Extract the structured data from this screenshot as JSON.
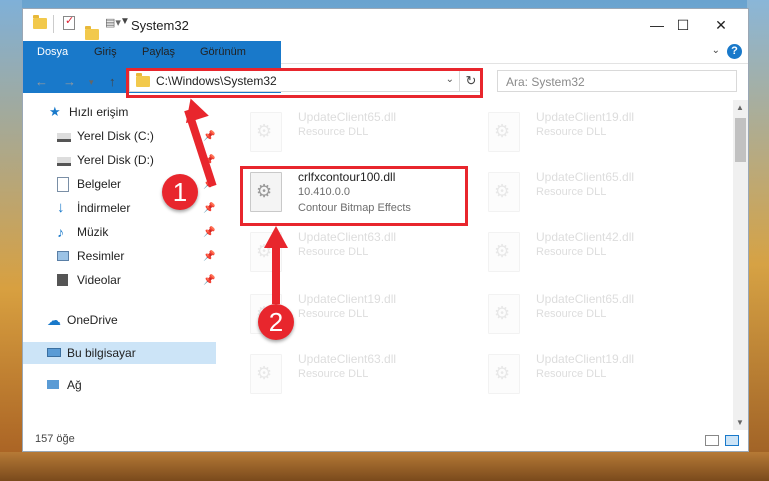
{
  "window": {
    "title": "System32"
  },
  "ribbon": {
    "tabs": [
      "Dosya",
      "Giriş",
      "Paylaş",
      "Görünüm"
    ],
    "help": "?"
  },
  "address": {
    "path": "C:\\Windows\\System32",
    "refresh": "↻"
  },
  "search": {
    "placeholder": "Ara: System32"
  },
  "sidebar": {
    "quick_access": "Hızlı erişim",
    "items": [
      {
        "label": "Yerel Disk (C:)",
        "icon": "drive-icon"
      },
      {
        "label": "Yerel Disk (D:)",
        "icon": "drive-icon"
      },
      {
        "label": "Belgeler",
        "icon": "documents-icon"
      },
      {
        "label": "İndirmeler",
        "icon": "downloads-icon"
      },
      {
        "label": "Müzik",
        "icon": "music-icon"
      },
      {
        "label": "Resimler",
        "icon": "pictures-icon"
      },
      {
        "label": "Videolar",
        "icon": "videos-icon"
      }
    ],
    "onedrive": "OneDrive",
    "this_pc": "Bu bilgisayar",
    "network": "Ağ"
  },
  "files": {
    "highlighted": {
      "name": "crlfxcontour100.dll",
      "version": "10.410.0.0",
      "desc": "Contour Bitmap Effects"
    },
    "faded_type": "Resource DLL",
    "left": [
      "UpdateClient65.dll",
      "UpdateClient63.dll",
      "UpdateClient19.dll",
      "UpdateClient63.dll"
    ],
    "right": [
      "UpdateClient19.dll",
      "UpdateClient65.dll",
      "UpdateClient42.dll",
      "UpdateClient65.dll",
      "UpdateClient19.dll"
    ]
  },
  "status": {
    "count": "157 öğe"
  },
  "annotations": {
    "badge1": "1",
    "badge2": "2"
  },
  "colors": {
    "accent": "#1979ca",
    "highlight": "#e8262d"
  }
}
